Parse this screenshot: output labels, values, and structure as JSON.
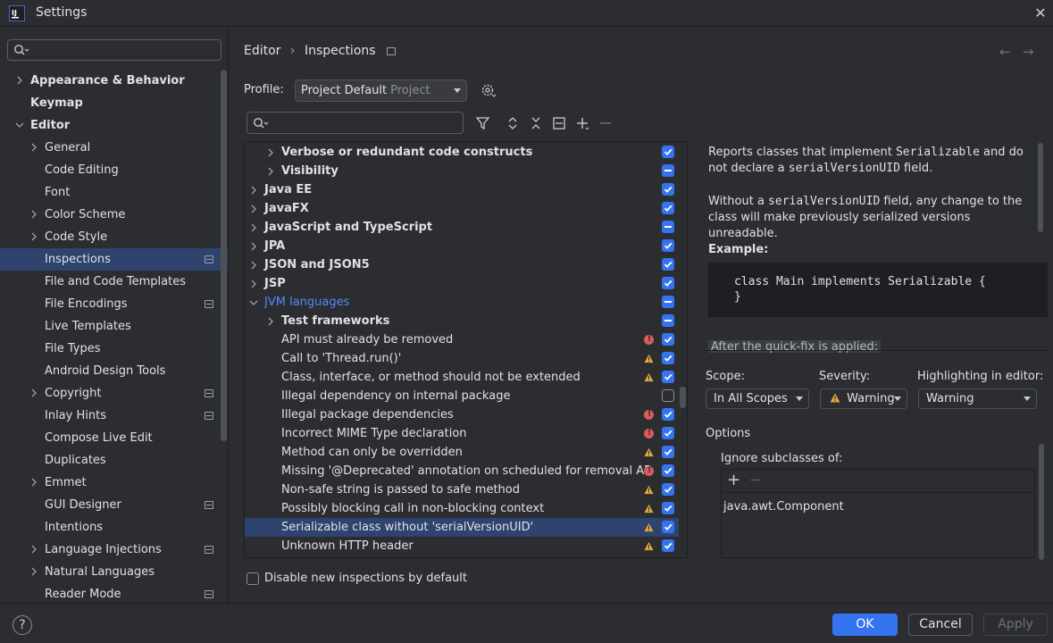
{
  "window": {
    "title": "Settings",
    "close_icon": "close-icon"
  },
  "sidebar": {
    "search_placeholder": "",
    "items": [
      {
        "label": "Appearance & Behavior",
        "bold": true,
        "chevron": "right"
      },
      {
        "label": "Keymap",
        "bold": true
      },
      {
        "label": "Editor",
        "bold": true,
        "chevron": "down"
      },
      {
        "label": "General",
        "chevron": "right"
      },
      {
        "label": "Code Editing"
      },
      {
        "label": "Font"
      },
      {
        "label": "Color Scheme",
        "chevron": "right"
      },
      {
        "label": "Code Style",
        "chevron": "right"
      },
      {
        "label": "Inspections",
        "selected": true,
        "project_icon": true
      },
      {
        "label": "File and Code Templates"
      },
      {
        "label": "File Encodings",
        "project_icon": true
      },
      {
        "label": "Live Templates"
      },
      {
        "label": "File Types"
      },
      {
        "label": "Android Design Tools"
      },
      {
        "label": "Copyright",
        "chevron": "right",
        "project_icon": true
      },
      {
        "label": "Inlay Hints",
        "project_icon": true
      },
      {
        "label": "Compose Live Edit"
      },
      {
        "label": "Duplicates"
      },
      {
        "label": "Emmet",
        "chevron": "right"
      },
      {
        "label": "GUI Designer",
        "project_icon": true
      },
      {
        "label": "Intentions"
      },
      {
        "label": "Language Injections",
        "chevron": "right",
        "project_icon": true
      },
      {
        "label": "Natural Languages",
        "chevron": "right"
      },
      {
        "label": "Reader Mode",
        "project_icon": true
      }
    ]
  },
  "breadcrumb": {
    "parent": "Editor",
    "current": "Inspections"
  },
  "profile": {
    "label": "Profile:",
    "value": "Project Default",
    "hint": "Project"
  },
  "inspections": {
    "search_placeholder": "",
    "rows": [
      {
        "label": "Verbose or redundant code constructs",
        "bold": true,
        "level": 1,
        "chevron": "right",
        "check": "on"
      },
      {
        "label": "Visibility",
        "bold": true,
        "level": 1,
        "chevron": "right",
        "check": "mixed"
      },
      {
        "label": "Java EE",
        "bold": true,
        "level": 0,
        "chevron": "right",
        "check": "on"
      },
      {
        "label": "JavaFX",
        "bold": true,
        "level": 0,
        "chevron": "right",
        "check": "on"
      },
      {
        "label": "JavaScript and TypeScript",
        "bold": true,
        "level": 0,
        "chevron": "right",
        "check": "mixed"
      },
      {
        "label": "JPA",
        "bold": true,
        "level": 0,
        "chevron": "right",
        "check": "on"
      },
      {
        "label": "JSON and JSON5",
        "bold": true,
        "level": 0,
        "chevron": "right",
        "check": "on"
      },
      {
        "label": "JSP",
        "bold": true,
        "level": 0,
        "chevron": "right",
        "check": "on"
      },
      {
        "label": "JVM languages",
        "bold": false,
        "blue": true,
        "level": 0,
        "chevron": "down",
        "check": "mixed"
      },
      {
        "label": "Test frameworks",
        "bold": true,
        "level": 1,
        "chevron": "right",
        "check": "mixed"
      },
      {
        "label": "API must already be removed",
        "level": 1,
        "severity": "error",
        "check": "on"
      },
      {
        "label": "Call to 'Thread.run()'",
        "level": 1,
        "severity": "warning",
        "check": "on"
      },
      {
        "label": "Class, interface, or method should not be extended",
        "level": 1,
        "severity": "warning",
        "check": "on"
      },
      {
        "label": "Illegal dependency on internal package",
        "level": 1,
        "check": "off"
      },
      {
        "label": "Illegal package dependencies",
        "level": 1,
        "severity": "error",
        "check": "on"
      },
      {
        "label": "Incorrect MIME Type declaration",
        "level": 1,
        "severity": "error",
        "check": "on"
      },
      {
        "label": "Method can only be overridden",
        "level": 1,
        "severity": "warning",
        "check": "on"
      },
      {
        "label": "Missing '@Deprecated' annotation on scheduled for removal AP",
        "level": 1,
        "severity": "error",
        "check": "on"
      },
      {
        "label": "Non-safe string is passed to safe method",
        "level": 1,
        "severity": "warning",
        "check": "on"
      },
      {
        "label": "Possibly blocking call in non-blocking context",
        "level": 1,
        "severity": "warning",
        "check": "on"
      },
      {
        "label": "Serializable class without 'serialVersionUID'",
        "level": 1,
        "severity": "warning",
        "check": "on",
        "selected": true
      },
      {
        "label": "Unknown HTTP header",
        "level": 1,
        "severity": "warning",
        "check": "on"
      }
    ]
  },
  "disable_new": {
    "label": "Disable new inspections by default",
    "checked": false
  },
  "description": {
    "p1_a": "Reports classes that implement ",
    "p1_code": "Serializable",
    "p1_b": " and do not declare a ",
    "p1_code2": "serialVersionUID",
    "p1_c": " field.",
    "p2_a": "Without a ",
    "p2_code": "serialVersionUID",
    "p2_b": " field, any change to the class will make previously serialized versions unreadable.",
    "example_label": "Example:",
    "code_line1": "class Main implements Serializable {",
    "code_line2": "}",
    "after_fix": "After the quick-fix is applied:"
  },
  "scope": {
    "label": "Scope:",
    "value": "In All Scopes"
  },
  "severity": {
    "label": "Severity:",
    "value": "Warning"
  },
  "highlighting": {
    "label": "Highlighting in editor:",
    "value": "Warning"
  },
  "options": {
    "title": "Options",
    "ignore_label": "Ignore subclasses of:",
    "add_symbol": "+",
    "remove_symbol": "—",
    "classes": [
      "java.awt.Component"
    ]
  },
  "buttons": {
    "ok": "OK",
    "cancel": "Cancel",
    "apply": "Apply",
    "help": "?"
  },
  "colors": {
    "accent": "#3574f0",
    "selection": "#2e436e",
    "warning": "#e5a83b",
    "error": "#db5c5c",
    "link": "#548af7"
  }
}
